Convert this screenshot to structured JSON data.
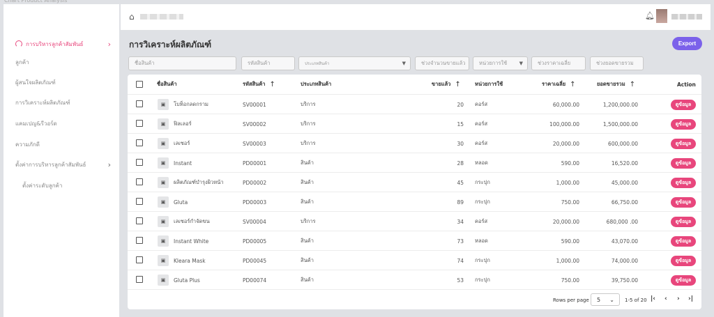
{
  "window": {
    "title": "Chart Product Analysis"
  },
  "sidebar": {
    "items": [
      {
        "label": "การบริหารลูกค้าสัมพันธ์",
        "active": true
      },
      {
        "label": "ลูกค้า"
      },
      {
        "label": "ผู้สนใจผลิตภัณฑ์"
      },
      {
        "label": "การวิเคราะห์ผลิตภัณฑ์"
      },
      {
        "label": "แคมเปญ&รีวอร์ด"
      },
      {
        "label": "ความภักดี"
      },
      {
        "label": "ตั้งค่าการบริหารลูกค้าสัมพันธ์"
      },
      {
        "label": "ตั้งค่าระดับลูกค้า"
      }
    ]
  },
  "header": {
    "home_icon": "home-icon",
    "bell_icon": "bell-icon"
  },
  "page": {
    "title": "การวิเคราะห์ผลิตภัณฑ์",
    "export_label": "Export"
  },
  "filters": {
    "product_name": "ชื่อสินค้า",
    "product_code": "รหัสสินค้า",
    "product_type": "ประเภทสินค้า",
    "sold_range": "ช่วงจำนวนขายแล้ว",
    "unit": "หน่วยการใช้",
    "avg_price_range": "ช่วงราคาเฉลี่ย",
    "total_sales_range": "ช่วงยอดขายรวม"
  },
  "table": {
    "headers": {
      "name": "ชื่อสินค้า",
      "code": "รหัสสินค้า",
      "type": "ประเภทสินค้า",
      "sold": "ขายแล้ว",
      "unit": "หน่วยการใช้",
      "avg_price": "ราคาเฉลี่ย",
      "total": "ยอดขายรวม",
      "action": "Action"
    },
    "action_label": "ดูข้อมูล",
    "rows": [
      {
        "name": "โบท็อกลดกราม",
        "code": "SV00001",
        "type": "บริการ",
        "sold": "20",
        "unit": "คอร์ส",
        "avg_price": "60,000.00",
        "total": "1,200,000.00"
      },
      {
        "name": "ฟิลเลอร์",
        "code": "SV00002",
        "type": "บริการ",
        "sold": "15",
        "unit": "คอร์ส",
        "avg_price": "100,000.00",
        "total": "1,500,000.00"
      },
      {
        "name": "เลเซอร์",
        "code": "SV00003",
        "type": "บริการ",
        "sold": "30",
        "unit": "คอร์ส",
        "avg_price": "20,000.00",
        "total": "600,000.00"
      },
      {
        "name": "Instant",
        "code": "PD00001",
        "type": "สินค้า",
        "sold": "28",
        "unit": "หลอด",
        "avg_price": "590.00",
        "total": "16,520.00"
      },
      {
        "name": "ผลิตภัณฑ์บำรุงผิวหน้า",
        "code": "PD00002",
        "type": "สินค้า",
        "sold": "45",
        "unit": "กระปุก",
        "avg_price": "1,000.00",
        "total": "45,000.00"
      },
      {
        "name": "Gluta",
        "code": "PD00003",
        "type": "สินค้า",
        "sold": "89",
        "unit": "กระปุก",
        "avg_price": "750.00",
        "total": "66,750.00"
      },
      {
        "name": "เลเซอร์กำจัดขน",
        "code": "SV00004",
        "type": "บริการ",
        "sold": "34",
        "unit": "คอร์ส",
        "avg_price": "20,000.00",
        "total": "680,000 .00"
      },
      {
        "name": "Instant White",
        "code": "PD00005",
        "type": "สินค้า",
        "sold": "73",
        "unit": "หลอด",
        "avg_price": "590.00",
        "total": "43,070.00"
      },
      {
        "name": "Kleara Mask",
        "code": "PD00045",
        "type": "สินค้า",
        "sold": "74",
        "unit": "กระปุก",
        "avg_price": "1,000.00",
        "total": "74,000.00"
      },
      {
        "name": "Gluta Plus",
        "code": "PD00074",
        "type": "สินค้า",
        "sold": "53",
        "unit": "กระปุก",
        "avg_price": "750.00",
        "total": "39,750.00"
      }
    ]
  },
  "pagination": {
    "rows_per_page_label": "Rows per page",
    "rows_per_page": "5",
    "range": "1-5 of 20"
  }
}
